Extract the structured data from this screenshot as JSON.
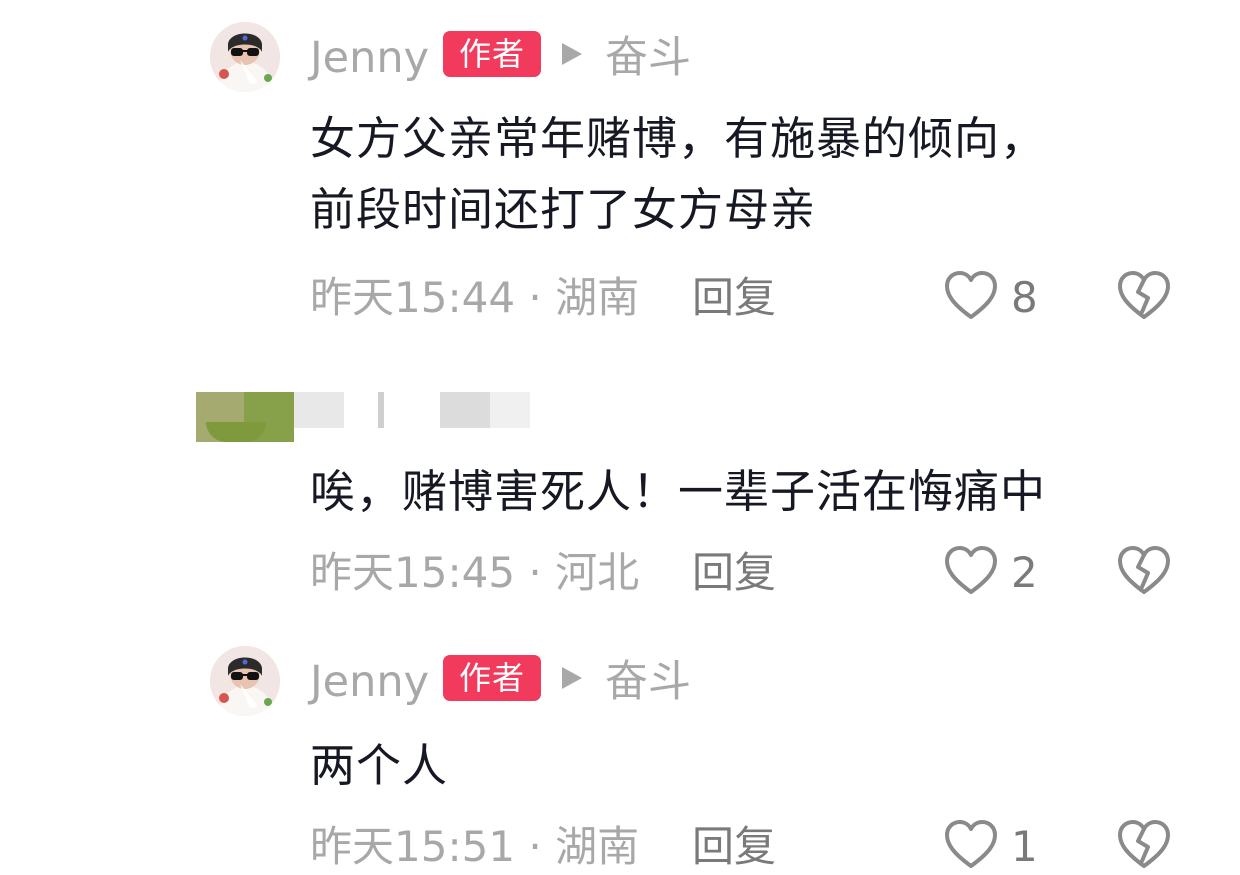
{
  "comments": [
    {
      "author": "Jenny",
      "badge": "作者",
      "reply_to": "奋斗",
      "body_lines": [
        "女方父亲常年赌博，有施暴的倾向，",
        "前段时间还打了女方母亲"
      ],
      "time_location": "昨天15:44 · 湖南",
      "reply_label": "回复",
      "likes": "8"
    },
    {
      "author": "",
      "body_lines": [
        "唉，赌博害死人！一辈子活在悔痛中"
      ],
      "time_location": "昨天15:45 · 河北",
      "reply_label": "回复",
      "likes": "2"
    },
    {
      "author": "Jenny",
      "badge": "作者",
      "reply_to": "奋斗",
      "body_lines": [
        "两个人"
      ],
      "time_location": "昨天15:51 · 湖南",
      "reply_label": "回复",
      "likes": "1"
    }
  ],
  "colors": {
    "badge_bg": "#f23b5c",
    "meta_text": "#a8a8a8",
    "body_text": "#161823",
    "action_text": "#7a7a7a"
  },
  "icons": {
    "like": "heart-outline-icon",
    "dislike": "broken-heart-icon",
    "reply_indicator": "play-triangle-icon"
  }
}
